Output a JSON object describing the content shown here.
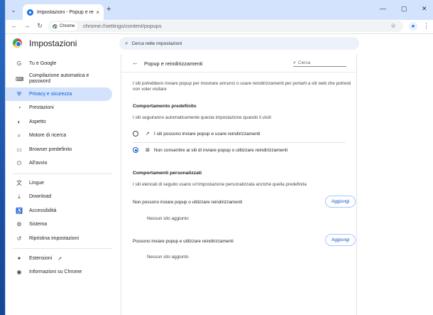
{
  "browser": {
    "tab_title": "Impostazioni - Popup e reindirizzamenti",
    "tab_close": "×",
    "new_tab": "+",
    "menu": "⌄",
    "window_controls": {
      "minimize": "—",
      "maximize": "▢",
      "close": "✕"
    },
    "chip_label": "Chrome",
    "url": "chrome://settings/content/popups"
  },
  "header": {
    "title": "Impostazioni",
    "search_placeholder": "Cerca nelle impostazioni"
  },
  "sidebar": {
    "items": [
      {
        "label": "Tu e Google",
        "icon": "G"
      },
      {
        "label": "Compilazione automatica e password",
        "icon": "⌨"
      },
      {
        "label": "Privacy e sicurezza",
        "icon": "⛨",
        "active": true
      },
      {
        "label": "Prestazioni",
        "icon": "◔"
      },
      {
        "label": "Aspetto",
        "icon": "◐"
      },
      {
        "label": "Motore di ricerca",
        "icon": "⌕"
      },
      {
        "label": "Browser predefinito",
        "icon": "▭"
      },
      {
        "label": "All'avvio",
        "icon": "⏻"
      },
      {
        "label": "Lingue",
        "icon": "文"
      },
      {
        "label": "Download",
        "icon": "⤓"
      },
      {
        "label": "Accessibilità",
        "icon": "♿"
      },
      {
        "label": "Sistema",
        "icon": "⚙"
      },
      {
        "label": "Ripristina impostazioni",
        "icon": "↺"
      },
      {
        "label": "Estensioni",
        "icon": "✦"
      },
      {
        "label": "Informazioni su Chrome",
        "icon": "◉"
      }
    ]
  },
  "card": {
    "title": "Popup e reindirizzamenti",
    "search_placeholder": "Cerca",
    "description": "I siti potrebbero inviare popup per mostrare annunci o usare reindirizzamenti per portarti a siti web che potresti non voler visitare",
    "default_heading": "Comportamento predefinito",
    "default_subtext": "I siti seguiranno automaticamente questa impostazione quando li visiti",
    "option_allow": "I siti possono inviare popup e usare reindirizzamenti",
    "option_block": "Non consentire ai siti di inviare popup o utilizzare reindirizzamenti",
    "custom_heading": "Comportamenti personalizzati",
    "custom_subtext": "I siti elencati di seguito usano un'impostazione personalizzata anziché quella predefinita",
    "blocked_label": "Non possono inviare popup o utilizzare reindirizzamenti",
    "blocked_empty": "Nessun sito aggiunto",
    "allowed_label": "Possono inviare popup e utilizzare reindirizzamenti",
    "allowed_empty": "Nessun sito aggiunto",
    "add_button": "Aggiungi"
  },
  "colors": {
    "accent": "#0b57d0",
    "active_bg": "#d3e3fd",
    "tabstrip": "#d3e3fd"
  }
}
